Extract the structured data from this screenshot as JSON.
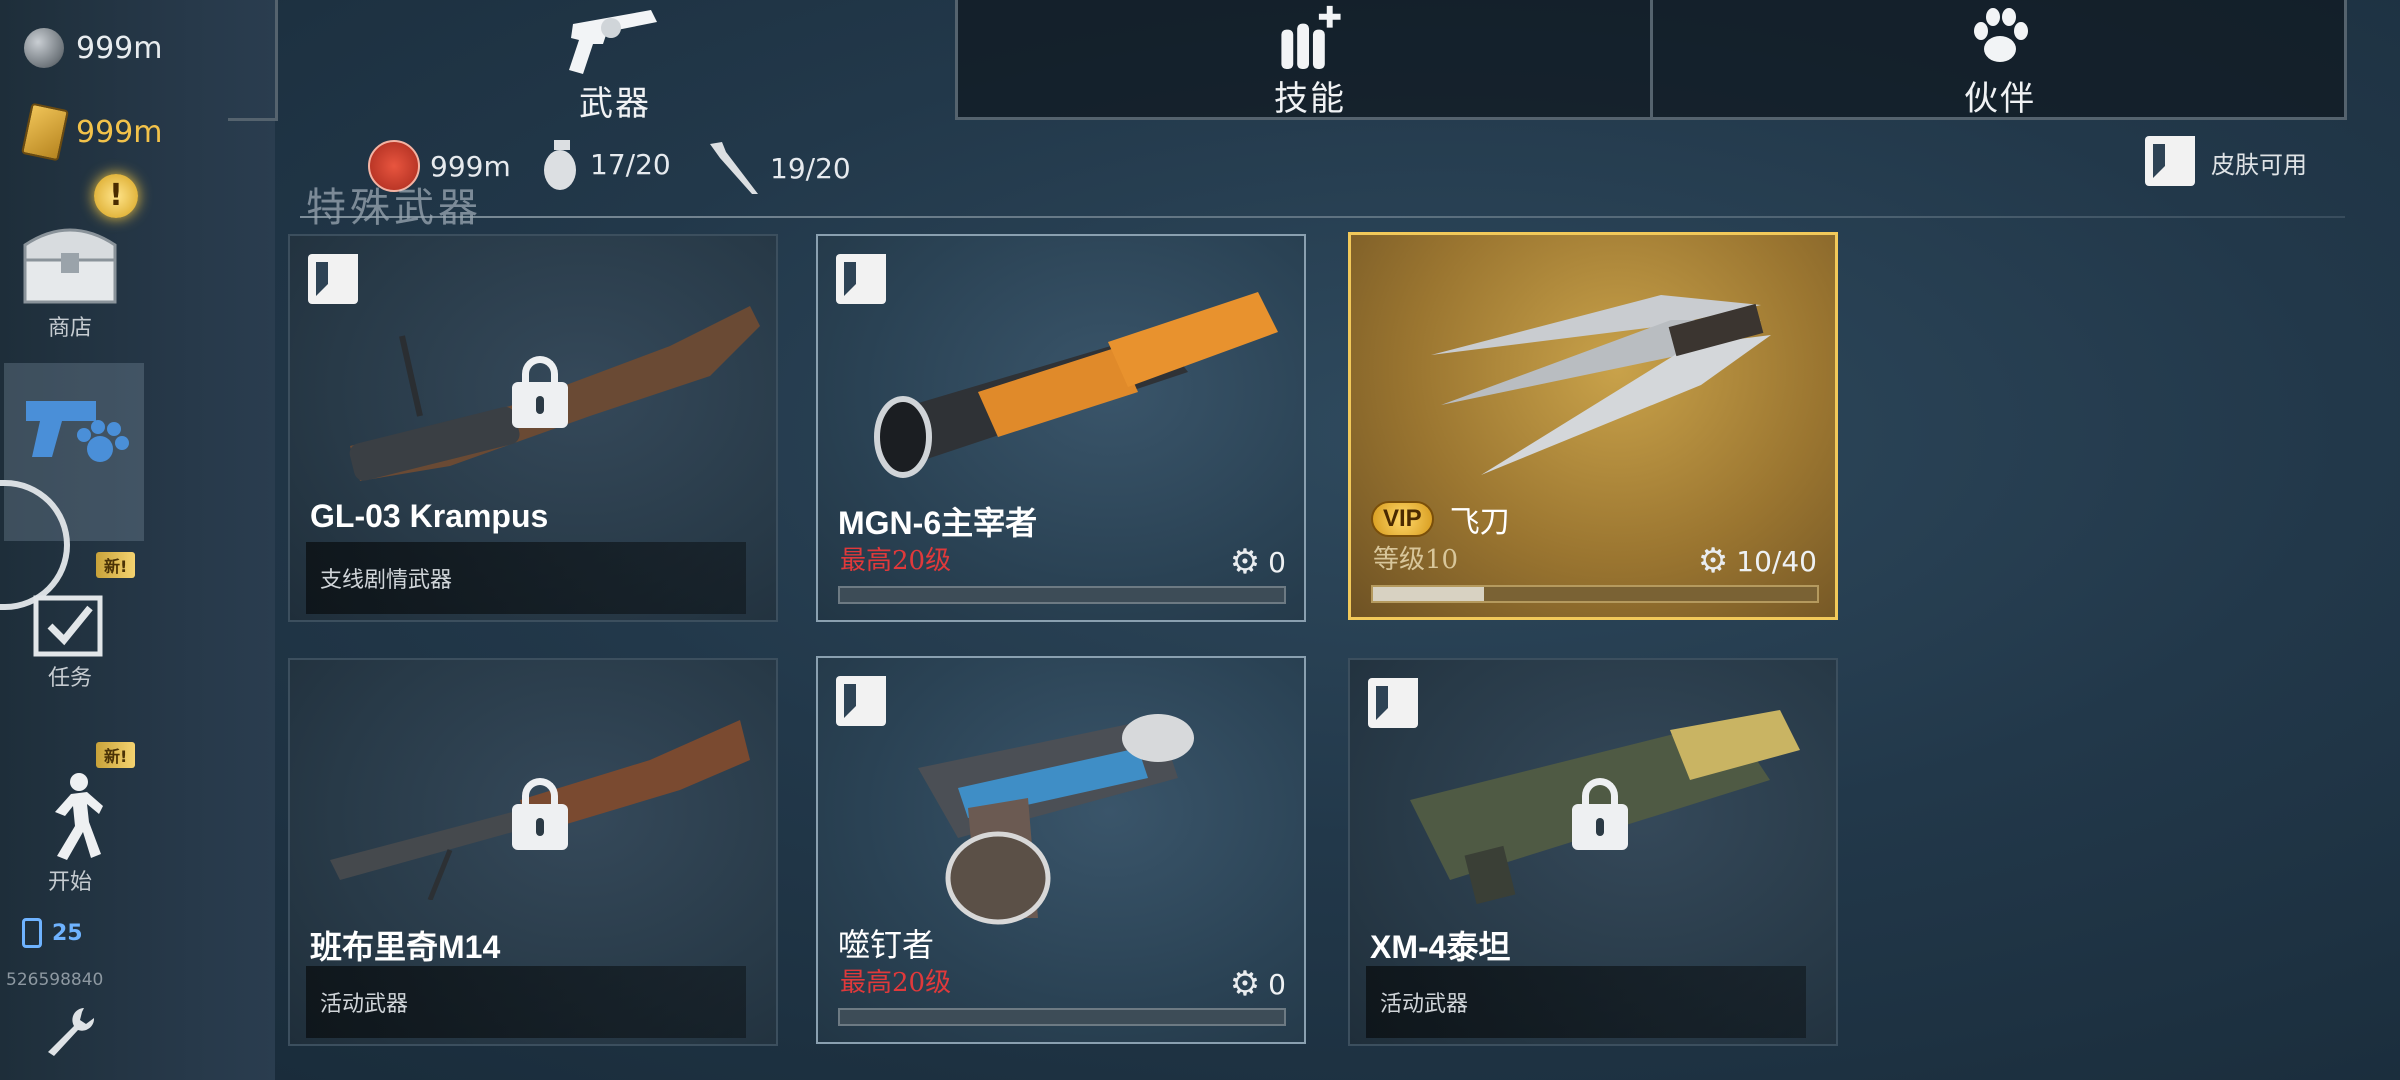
{
  "currencies": [
    {
      "icon": "silver-coin-icon",
      "value": "999m"
    },
    {
      "icon": "gold-bar-icon",
      "value": "999m",
      "color": "#f2c24a"
    }
  ],
  "sidebar": {
    "shop_label": "商店",
    "pets_label": "",
    "tasks_label": "任务",
    "start_label": "开始",
    "new_tag": "新!",
    "energy": "25",
    "player_id": "526598840"
  },
  "tabs": [
    {
      "icon": "revolver-icon",
      "label": "武器",
      "active": true
    },
    {
      "icon": "ammo-plus-icon",
      "label": "技能"
    },
    {
      "icon": "paw-icon",
      "label": "伙伴"
    }
  ],
  "stats": {
    "tokens": "999m",
    "grenades": "17/20",
    "knives": "19/20",
    "skin_available": "皮肤可用"
  },
  "section_title": "特殊武器",
  "weapons": [
    {
      "name": "GL-03 Krampus",
      "sub": "支线剧情武器",
      "locked": true
    },
    {
      "name": "MGN-6主宰者",
      "max_level": "最高20级",
      "gears": "0",
      "progress": 0
    },
    {
      "name": "飞刀",
      "vip": "VIP",
      "level": "等级10",
      "gears": "10/40",
      "progress": 0.25,
      "selected": true
    },
    {
      "name": "班布里奇M14",
      "sub": "活动武器",
      "locked": true
    },
    {
      "name": "噬钉者",
      "max_level": "最高20级",
      "gears": "0",
      "progress": 0
    },
    {
      "name": "XM-4泰坦",
      "sub": "活动武器",
      "locked": true
    }
  ],
  "colors": {
    "accent_gold": "#f2c95a",
    "max_level_red": "#e0393b"
  }
}
